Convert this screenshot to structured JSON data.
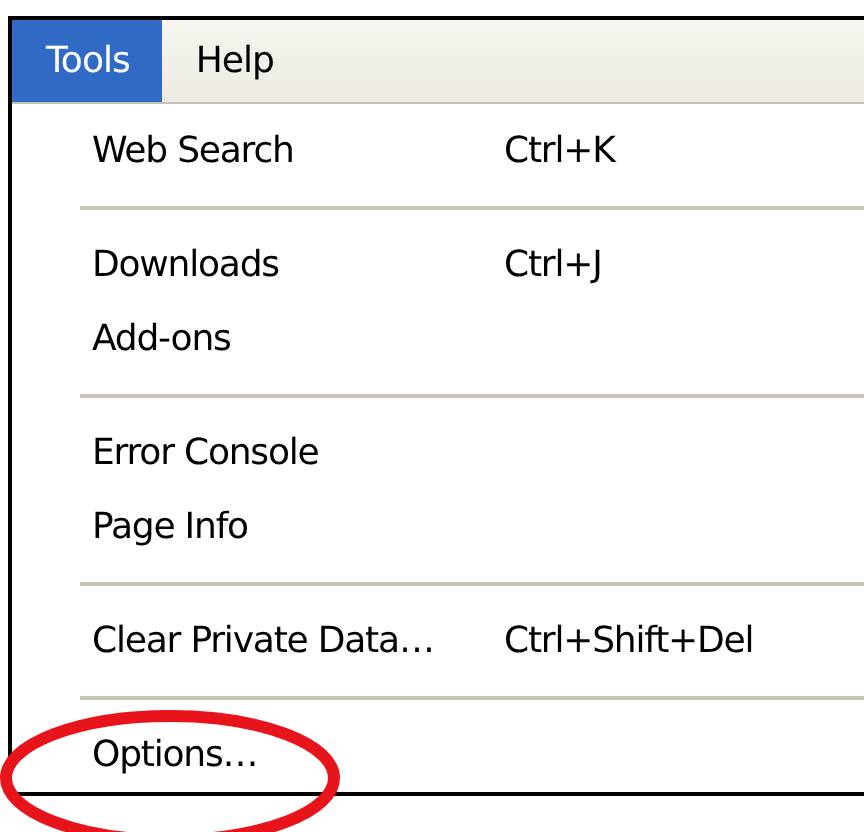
{
  "menubar": [
    {
      "label": "Tools",
      "selected": true
    },
    {
      "label": "Help",
      "selected": false
    }
  ],
  "menu": {
    "items": [
      {
        "kind": "command",
        "label": "Web Search",
        "shortcut": "Ctrl+K"
      },
      {
        "kind": "separator"
      },
      {
        "kind": "command",
        "label": "Downloads",
        "shortcut": "Ctrl+J"
      },
      {
        "kind": "command",
        "label": "Add-ons"
      },
      {
        "kind": "separator"
      },
      {
        "kind": "command",
        "label": "Error Console"
      },
      {
        "kind": "command",
        "label": "Page Info"
      },
      {
        "kind": "separator"
      },
      {
        "kind": "command",
        "label": "Clear Private Data…",
        "shortcut": "Ctrl+Shift+Del"
      },
      {
        "kind": "separator"
      },
      {
        "kind": "command",
        "label": "Options…"
      }
    ]
  },
  "annotation": {
    "kind": "ellipse",
    "color": "#e8141c"
  }
}
